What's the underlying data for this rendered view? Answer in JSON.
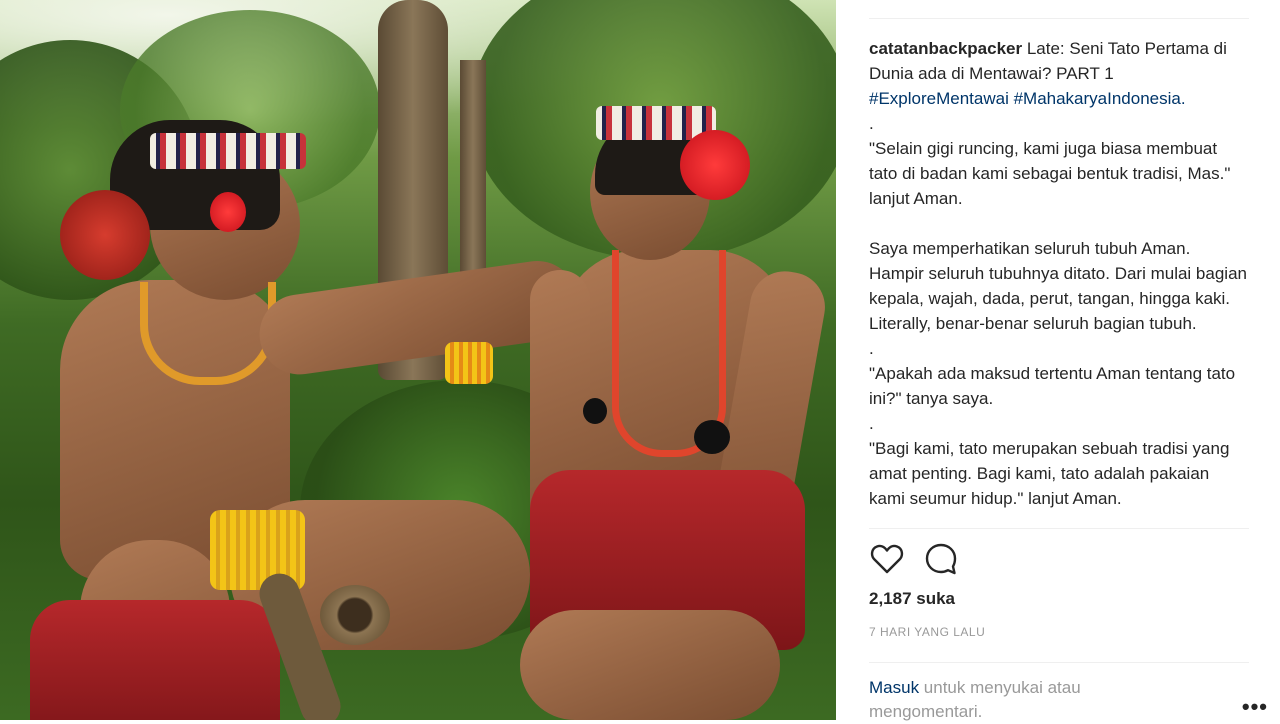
{
  "post": {
    "username": "catatanbackpacker",
    "caption_title": "Late: Seni Tato Pertama di Dunia ada di Mentawai? PART 1",
    "hashtags": "#ExploreMentawai #MahakaryaIndonesia.",
    "paragraphs": [
      ".",
      "\"Selain gigi runcing, kami juga biasa membuat tato di badan kami sebagai bentuk tradisi, Mas.\" lanjut Aman.",
      "",
      "Saya memperhatikan seluruh tubuh Aman. Hampir seluruh tubuhnya ditato. Dari mulai bagian kepala, wajah, dada, perut, tangan, hingga kaki. Literally, benar-benar seluruh bagian tubuh.",
      ".",
      "\"Apakah ada maksud tertentu Aman tentang tato ini?\" tanya saya.",
      ".",
      "\"Bagi kami, tato merupakan sebuah tradisi yang amat penting. Bagi kami, tato adalah pakaian kami seumur hidup.\" lanjut Aman."
    ],
    "likes": "2,187 suka",
    "time": "7 HARI YANG LALU",
    "login_link": "Masuk",
    "login_text": " untuk menyukai atau mengomentari.",
    "more": "•••"
  },
  "icons": {
    "like": "heart-icon",
    "comment": "comment-icon"
  }
}
